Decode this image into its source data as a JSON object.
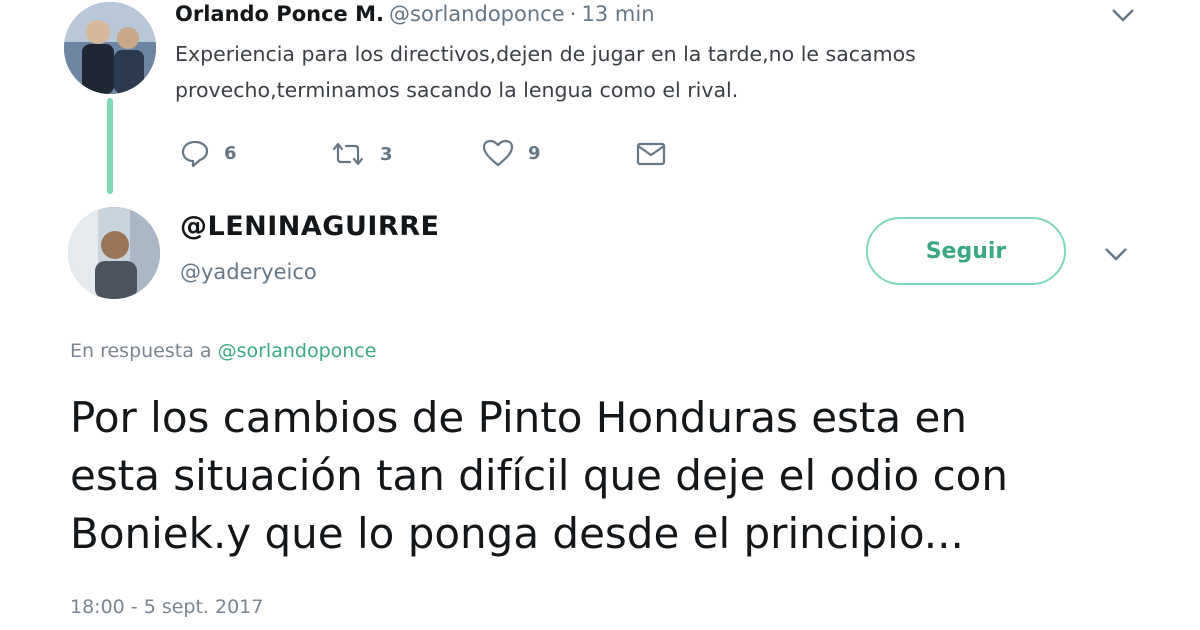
{
  "tweet1": {
    "name": "Orlando Ponce M.",
    "handle": "@sorlandoponce",
    "separator": "·",
    "time": "13 min",
    "text_line1": "Experiencia para los directivos,dejen de jugar en la tarde,no le sacamos",
    "text_line2": "provecho,terminamos sacando la lengua como el rival.",
    "actions": {
      "replies": "6",
      "retweets": "3",
      "likes": "9"
    },
    "icons": {
      "reply": "reply-icon",
      "retweet": "retweet-icon",
      "like": "heart-icon",
      "dm": "envelope-icon",
      "menu": "chevron-down-icon"
    }
  },
  "tweet2": {
    "name": "@LENINAGUIRRE",
    "handle": "@yaderyeico",
    "follow_label": "Seguir",
    "reply_prefix": "En respuesta a",
    "reply_mention": "@sorlandoponce",
    "text_line1": "Por los cambios de Pinto Honduras esta en",
    "text_line2": "esta situación tan difícil que deje el odio con",
    "text_line3": "Boniek.y que lo ponga desde el principio...",
    "timestamp": "18:00 - 5 sept. 2017"
  },
  "colors": {
    "accent_green": "#7fd8b6",
    "link_green": "#3aa883",
    "muted": "#657786",
    "text": "#14171a"
  }
}
